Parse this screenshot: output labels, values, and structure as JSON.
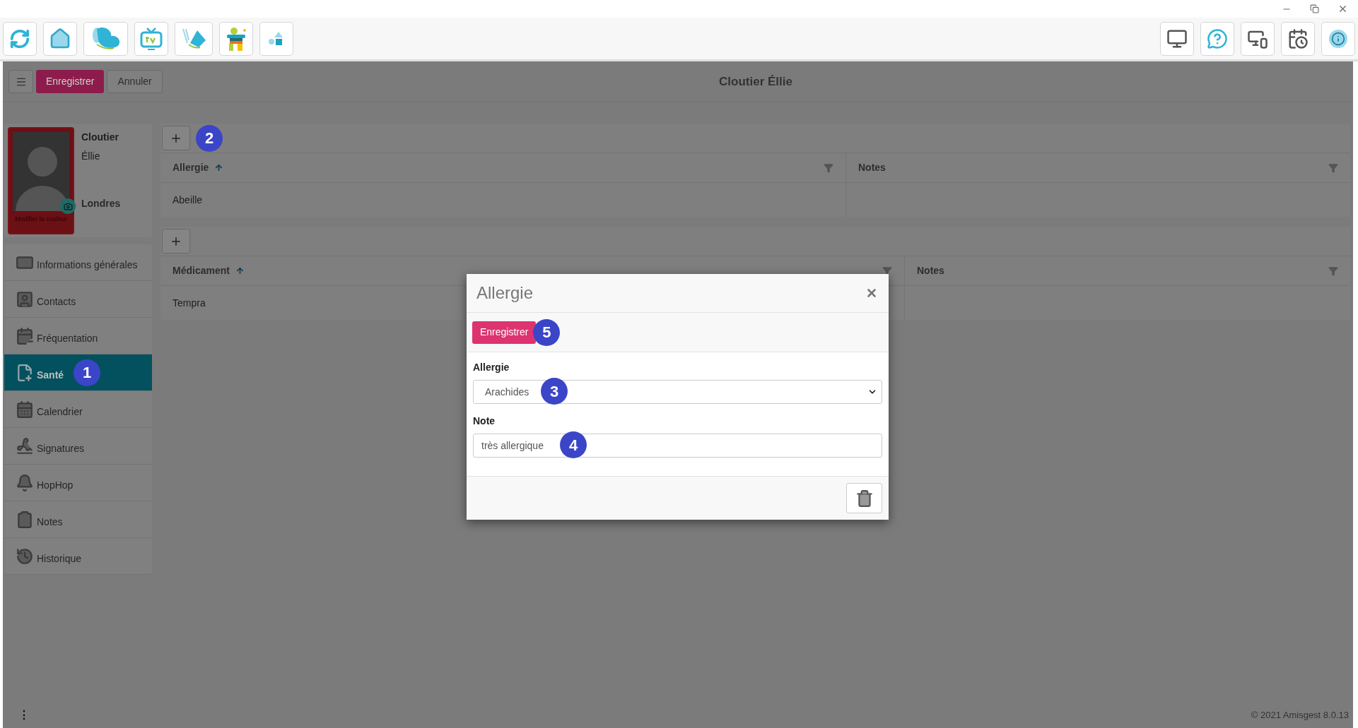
{
  "header": {
    "buttons": [
      {
        "label": "Enregistrer",
        "kind": "primary"
      },
      {
        "label": "Annuler",
        "kind": "default"
      }
    ],
    "title": "Cloutier Éllie"
  },
  "profile": {
    "last_name": "Cloutier",
    "first_name": "Éllie",
    "city": "Londres",
    "photo_caption": "Modifier la couleur"
  },
  "sidebar": {
    "items": [
      {
        "label": "Informations générales",
        "selected": false
      },
      {
        "label": "Contacts",
        "selected": false
      },
      {
        "label": "Fréquentation",
        "selected": false
      },
      {
        "label": "Santé",
        "selected": true,
        "marker": "1"
      },
      {
        "label": "Calendrier",
        "selected": false
      },
      {
        "label": "Signatures",
        "selected": false
      },
      {
        "label": "HopHop",
        "selected": false
      },
      {
        "label": "Notes",
        "selected": false
      },
      {
        "label": "Historique",
        "selected": false
      }
    ]
  },
  "tables": [
    {
      "add_marker": "2",
      "columns": [
        {
          "label": "Allergie",
          "sorted": true
        },
        {
          "label": "Notes",
          "sorted": false
        }
      ],
      "rows": [
        [
          "Abeille"
        ]
      ]
    },
    {
      "columns": [
        {
          "label": "Médicament",
          "sorted": true
        },
        {
          "label": "Notes",
          "sorted": false
        }
      ],
      "rows": [
        [
          "Tempra"
        ]
      ]
    }
  ],
  "modal": {
    "title": "Allergie",
    "save": "Enregistrer",
    "save_marker": "5",
    "fields": [
      {
        "kind": "select",
        "label": "Allergie",
        "value": "Arachides",
        "marker": "3"
      },
      {
        "kind": "text",
        "label": "Note",
        "value": "très allergique",
        "marker": "4"
      }
    ]
  },
  "footer": {
    "menu": "⋮",
    "copyright": "© 2021 Amisgest 8.0.13"
  }
}
